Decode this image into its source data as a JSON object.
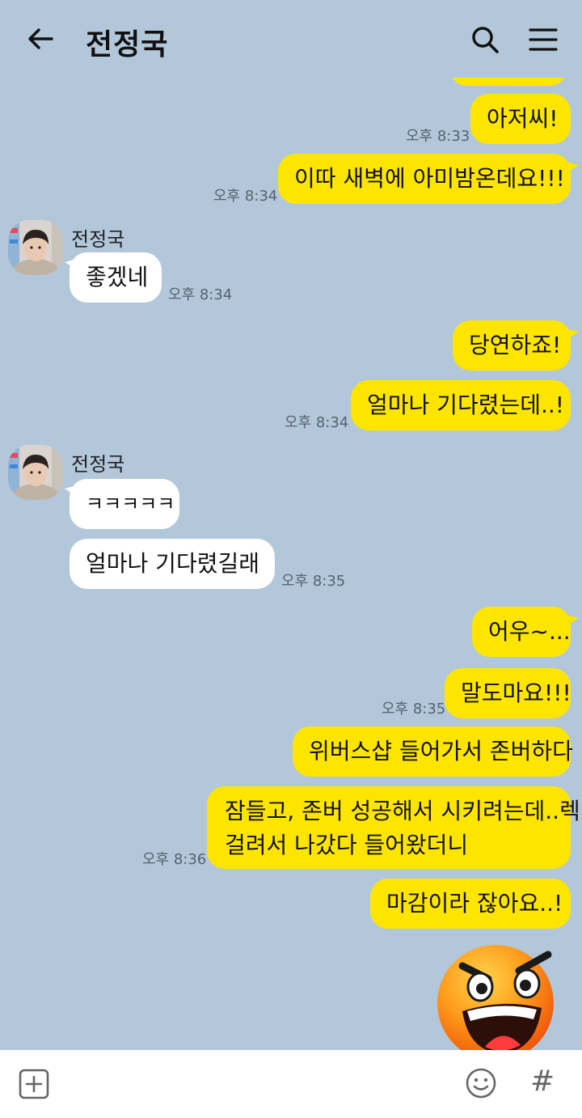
{
  "header": {
    "title": "전정국"
  },
  "contact": {
    "name": "전정국"
  },
  "messages": {
    "m1": {
      "text": "아저씨!",
      "time": "오후 8:33"
    },
    "m2": {
      "text": "이따 새벽에 아미밤온데요!!!",
      "time": "오후 8:34"
    },
    "m3": {
      "text": "좋겠네",
      "time": "오후 8:34"
    },
    "m4": {
      "text": "당연하죠!"
    },
    "m5": {
      "text": "얼마나 기다렸는데..!",
      "time": "오후 8:34"
    },
    "m6": {
      "text": "ㅋㅋㅋㅋㅋ"
    },
    "m7": {
      "text": "얼마나 기다렸길래",
      "time": "오후 8:35"
    },
    "m8": {
      "text": "어우~..."
    },
    "m9": {
      "text": "말도마요!!!",
      "time": "오후 8:35"
    },
    "m10": {
      "text": "위버스샵 들어가서 존버하다"
    },
    "m11": {
      "line1": "잠들고, 존버 성공해서 시키려는데..렉",
      "line2": "걸려서 나갔다 들어왔더니",
      "time": "오후 8:36"
    },
    "m12": {
      "text": "마감이라 잖아요..!"
    }
  },
  "colors": {
    "background": "#b2c7d9",
    "my_bubble": "#fee500",
    "their_bubble": "#ffffff"
  },
  "icons": {
    "back": "arrow-left-icon",
    "search": "search-icon",
    "menu": "hamburger-menu-icon",
    "attach": "plus-box-icon",
    "emoji": "smiley-icon",
    "hash": "hash-icon"
  },
  "composer": {
    "hash_glyph": "#"
  }
}
